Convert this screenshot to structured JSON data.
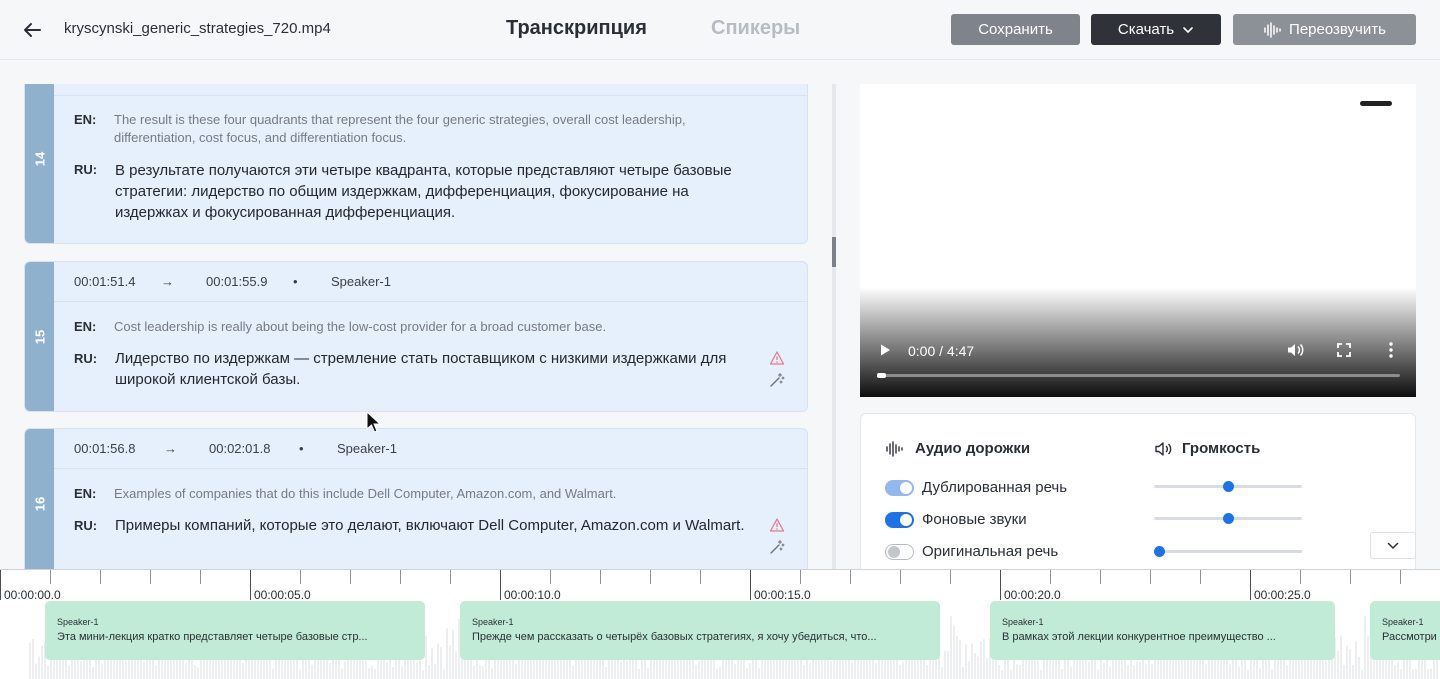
{
  "header": {
    "filename": "kryscynski_generic_strategies_720.mp4",
    "tab_active": "Транскрипция",
    "tab_inactive": "Спикеры",
    "save_label": "Сохранить",
    "download_label": "Скачать",
    "redub_label": "Переозвучить"
  },
  "segments": [
    {
      "number": "14",
      "en_label": "EN:",
      "en_text": "The result is these four quadrants that represent the four generic strategies, overall cost leadership, differentiation, cost focus, and differentiation focus.",
      "ru_label": "RU:",
      "ru_text": "В результате получаются эти четыре квадранта, которые представляют четыре базовые стратегии: лидерство по общим издержкам, дифференциация, фокусирование на издержках и фокусированная дифференциация."
    },
    {
      "number": "15",
      "start": "00:01:51.4",
      "arrow": "→",
      "end": "00:01:55.9",
      "dot": "•",
      "speaker": "Speaker-1",
      "en_label": "EN:",
      "en_text": "Cost leadership is really about being the low-cost provider for a broad customer base.",
      "ru_label": "RU:",
      "ru_text": "Лидерство по издержкам — стремление стать поставщиком с низкими издержками для широкой клиентской базы."
    },
    {
      "number": "16",
      "start": "00:01:56.8",
      "arrow": "→",
      "end": "00:02:01.8",
      "dot": "•",
      "speaker": "Speaker-1",
      "en_label": "EN:",
      "en_text": "Examples of companies that do this include Dell Computer, Amazon.com, and Walmart.",
      "ru_label": "RU:",
      "ru_text": "Примеры компаний, которые это делают, включают Dell Computer, Amazon.com и Walmart."
    }
  ],
  "video": {
    "time": "0:00 / 4:47",
    "progress_fraction": 0.0
  },
  "audio": {
    "tracks_title": "Аудио дорожки",
    "volume_title": "Громкость",
    "tracks": [
      {
        "label": "Дублированная речь",
        "on": true,
        "disabled": true,
        "volume": 0.5
      },
      {
        "label": "Фоновые звуки",
        "on": true,
        "disabled": false,
        "volume": 0.5
      },
      {
        "label": "Оригинальная речь",
        "on": false,
        "disabled": false,
        "volume": 0.0
      }
    ]
  },
  "timeline": {
    "labels": [
      "00:00:00.0",
      "00:00:05.0",
      "00:00:10.0",
      "00:00:15.0",
      "00:00:20.0",
      "00:00:25.0"
    ],
    "clips": [
      {
        "speaker": "Speaker-1",
        "text": "Эта мини-лекция кратко представляет четыре базовые стр..."
      },
      {
        "speaker": "Speaker-1",
        "text": "Прежде чем рассказать о четырёх базовых стратегиях, я хочу убедиться, что..."
      },
      {
        "speaker": "Speaker-1",
        "text": "В рамках этой лекции конкурентное преимущество ..."
      },
      {
        "speaker": "Speaker-1",
        "text": "Рассмотри"
      }
    ]
  },
  "colors": {
    "accent": "#1a73e8",
    "segment_bg": "#e6effc",
    "segment_number_bg": "#8fb1ce",
    "clip_bg": "#c1ebd6",
    "warning": "#e57a8a"
  }
}
